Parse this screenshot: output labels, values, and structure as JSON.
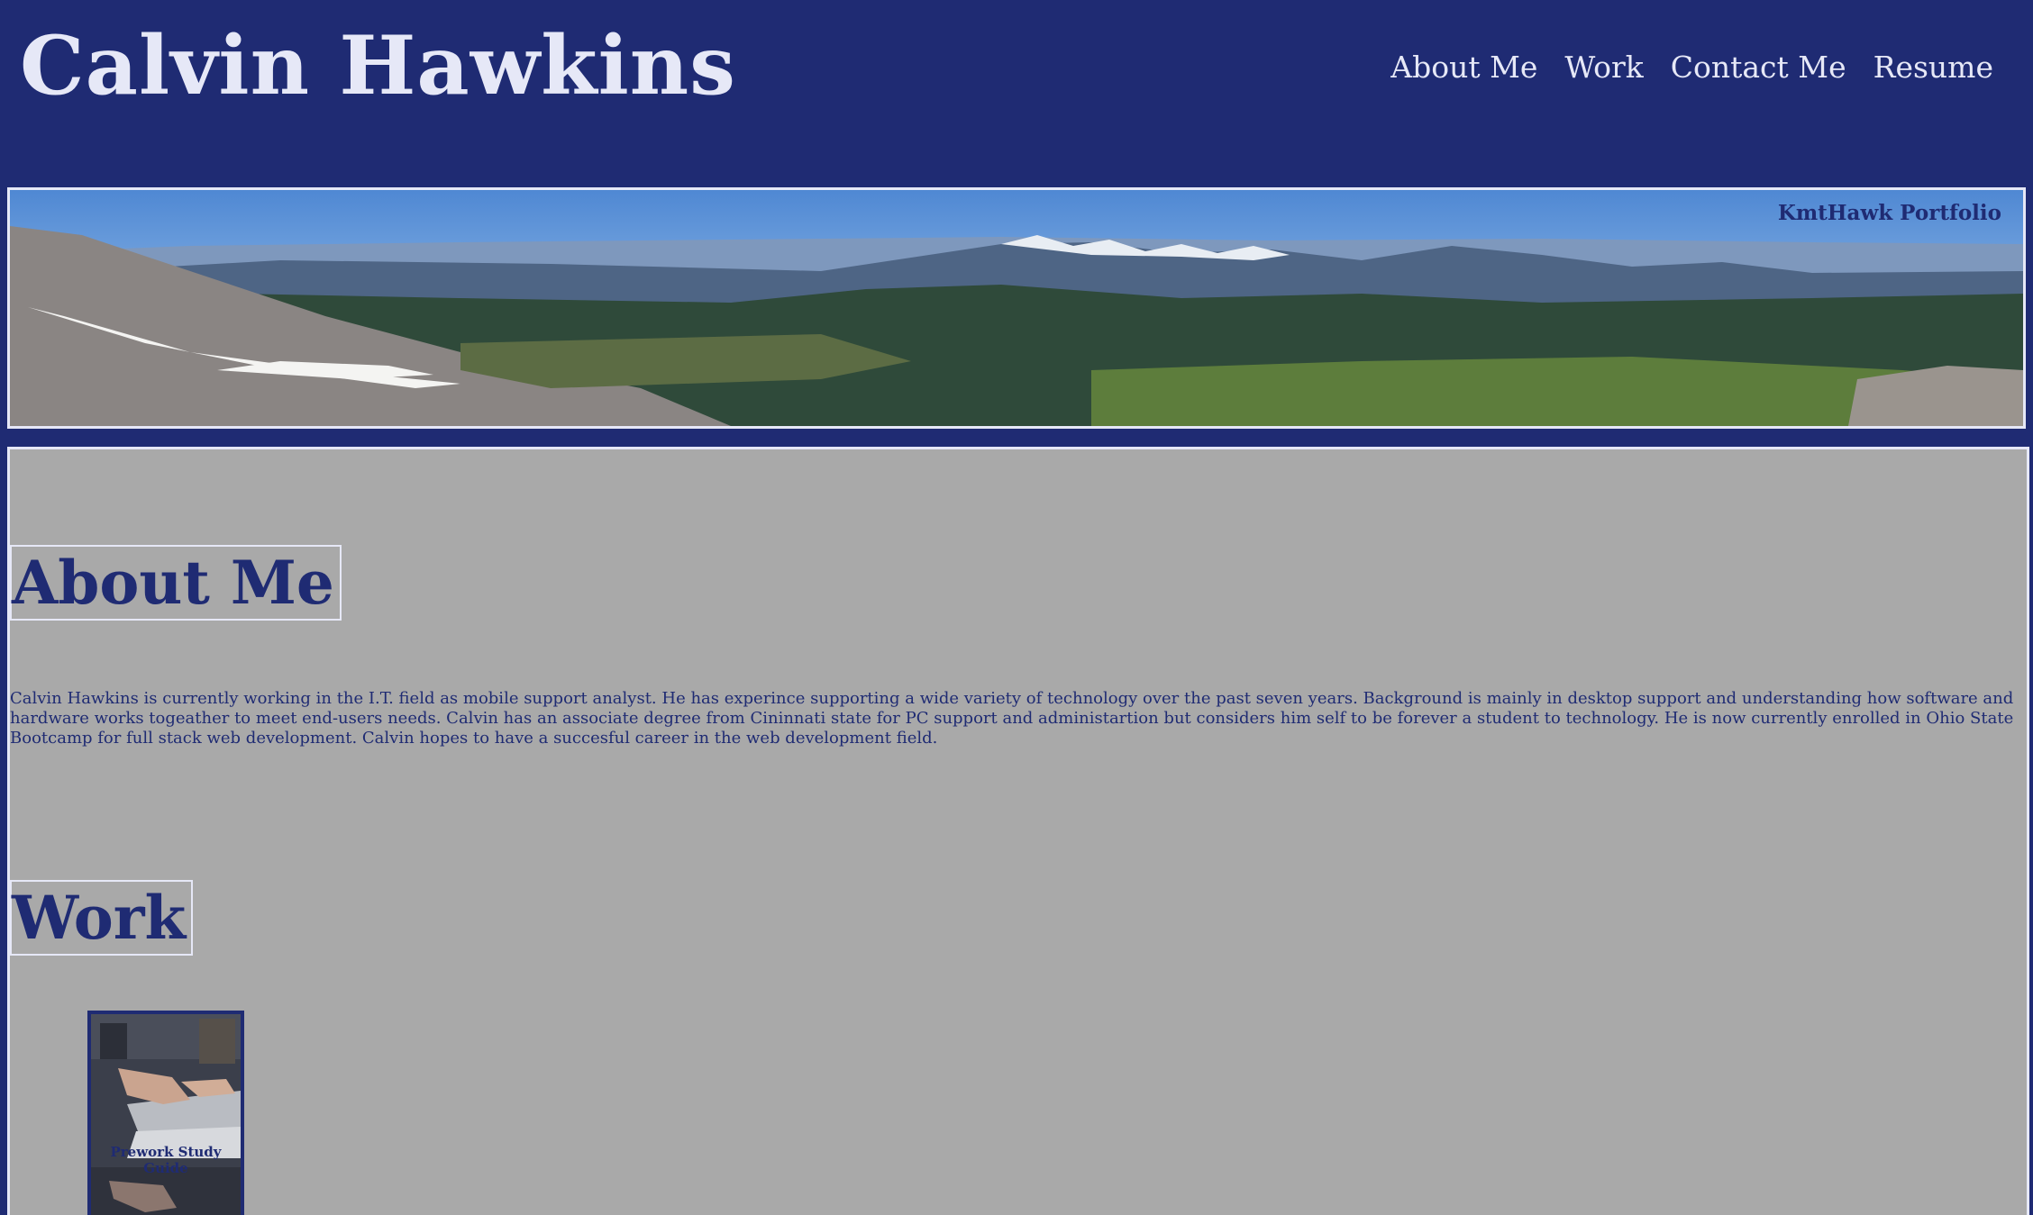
{
  "header": {
    "title": "Calvin Hawkins",
    "nav": [
      {
        "label": "About Me"
      },
      {
        "label": "Work"
      },
      {
        "label": "Contact Me"
      },
      {
        "label": "Resume"
      }
    ]
  },
  "hero": {
    "caption": "KmtHawk Portfolio",
    "image": "mountain-panorama-banner"
  },
  "about": {
    "heading": "About Me",
    "text": "Calvin Hawkins is currently working in the I.T. field as mobile support analyst. He has experince supporting a wide variety of technology over the past seven years. Background is mainly in desktop support and understanding how software and hardware works togeather to meet end-users needs. Calvin has an associate degree from Cininnati state for PC support and administartion but considers him self to be forever a student to technology. He is now currently enrolled in Ohio State Bootcamp for full stack web development. Calvin hopes to have a succesful career in the web development field."
  },
  "work": {
    "heading": "Work",
    "items": [
      {
        "label": "Prework Study Guide",
        "image": "laptop-hands-photo"
      }
    ]
  },
  "colors": {
    "navy": "#1f2b73",
    "light": "#e6e8f7",
    "panel": "#a9a9a9"
  }
}
